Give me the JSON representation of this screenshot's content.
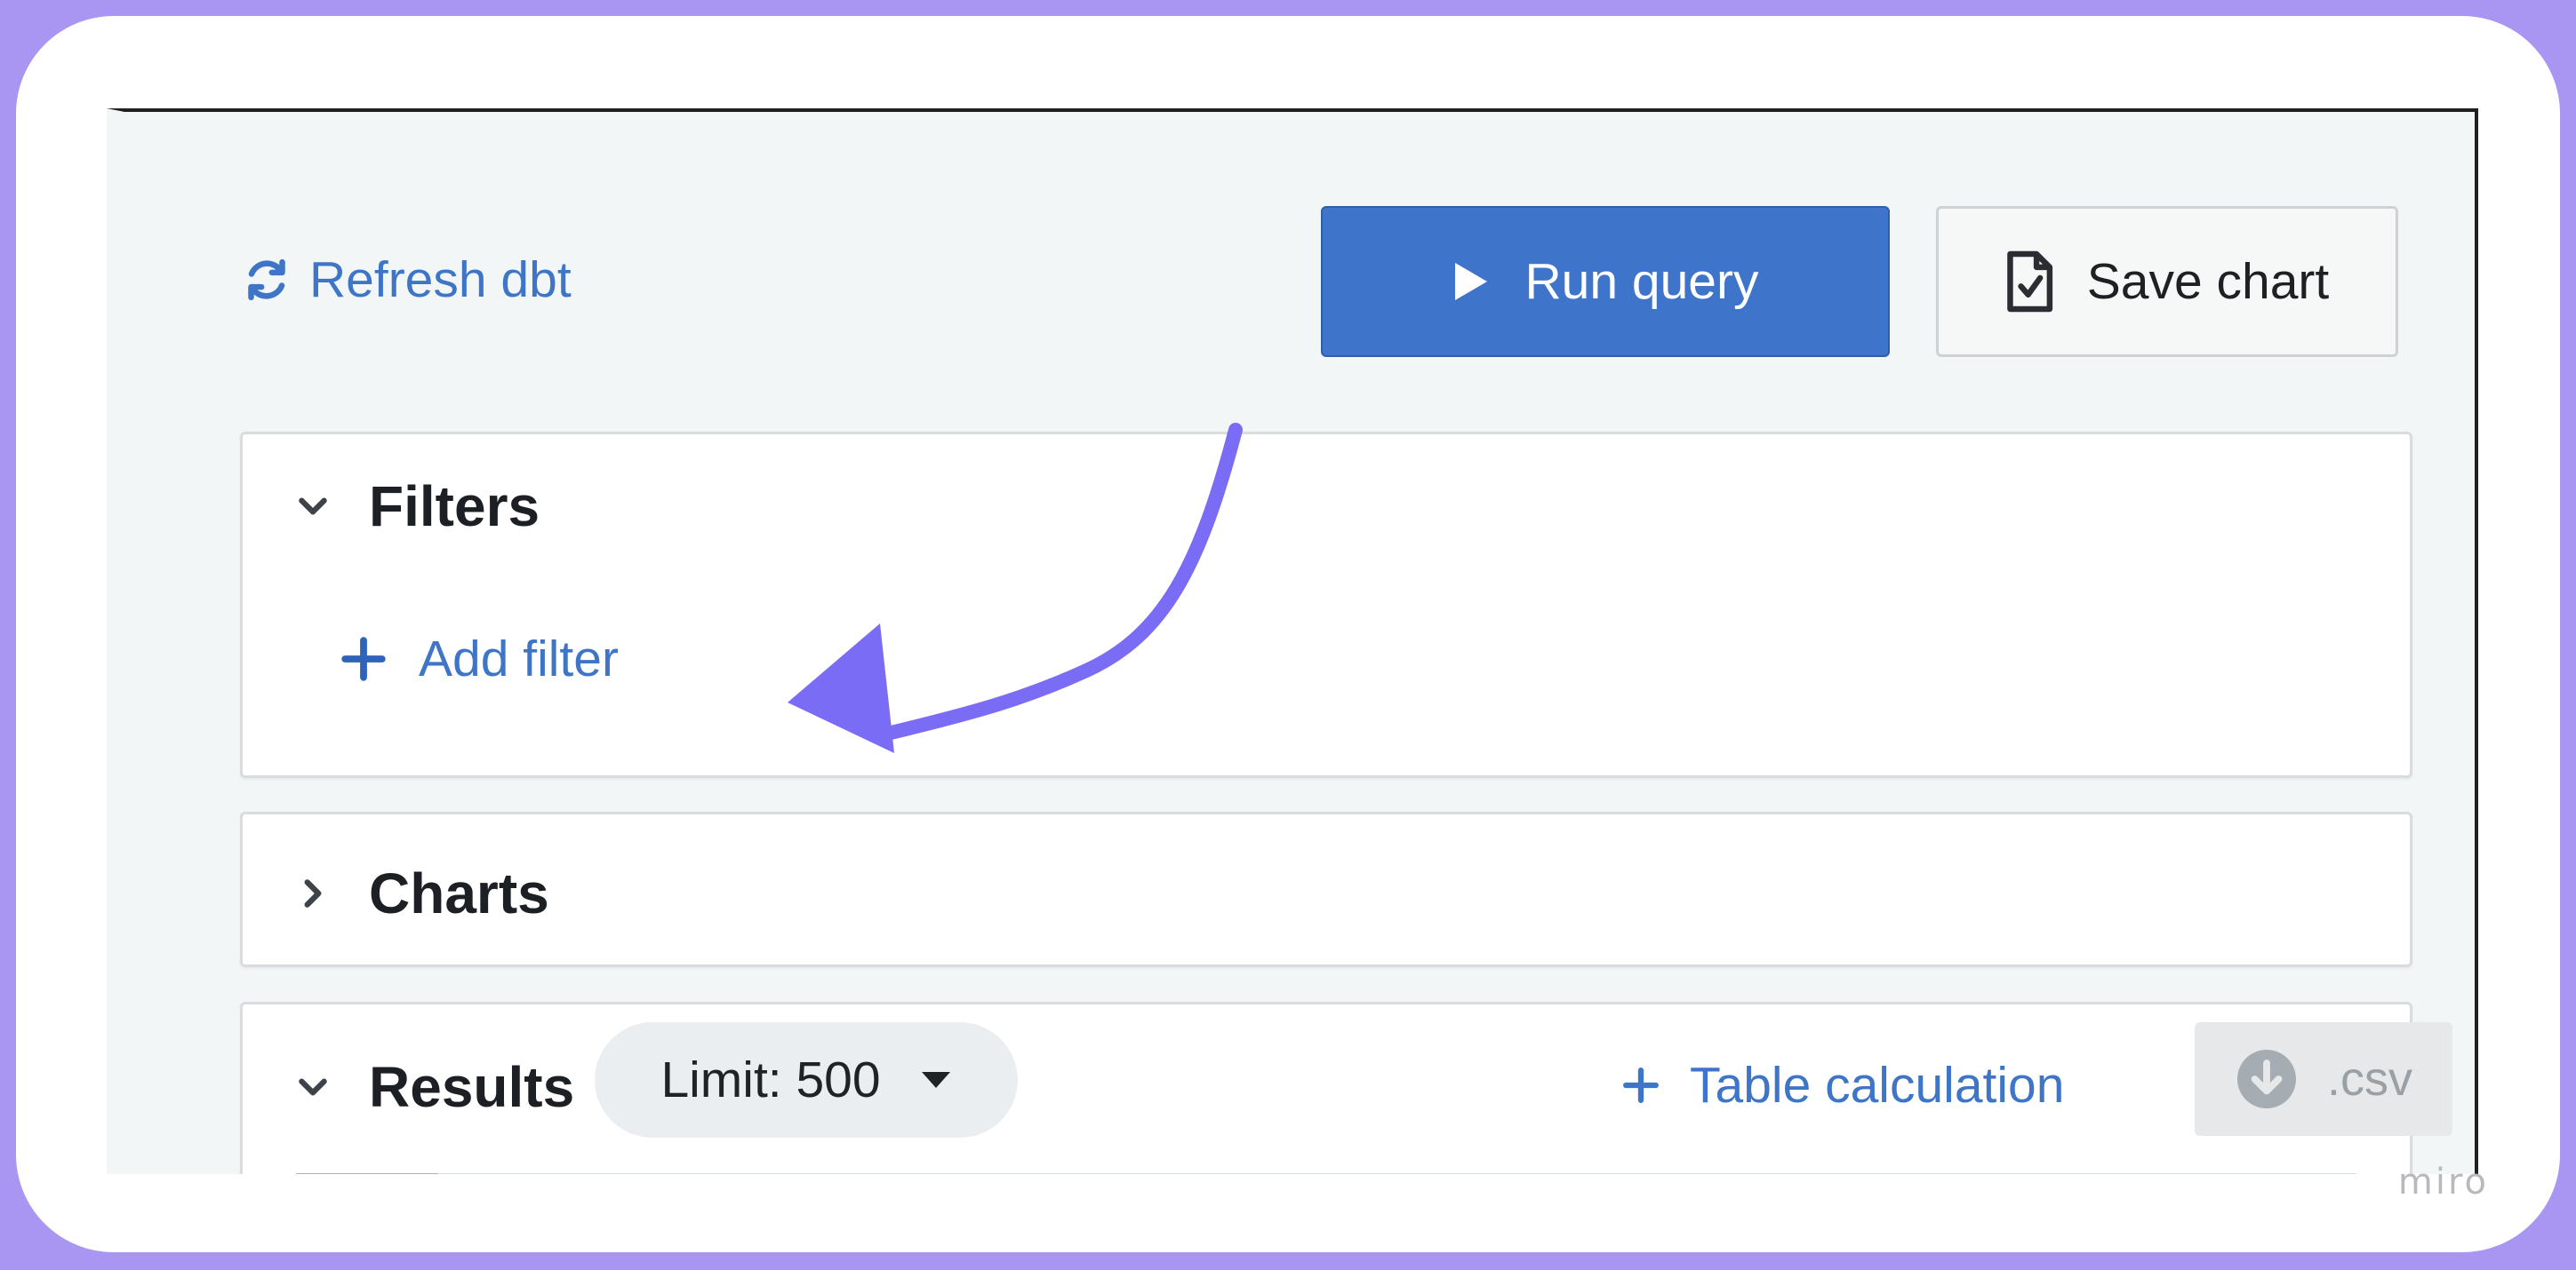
{
  "toolbar": {
    "refresh_label": "Refresh dbt",
    "run_label": "Run query",
    "save_label": "Save chart"
  },
  "filters": {
    "title": "Filters",
    "expanded": true,
    "add_label": "Add filter"
  },
  "charts": {
    "title": "Charts",
    "expanded": false
  },
  "results": {
    "title": "Results",
    "expanded": true,
    "limit_label": "Limit: 500",
    "table_calc_label": "Table calculation",
    "csv_label": ".csv"
  },
  "annotation": {
    "arrow_color": "#7b6cf6"
  },
  "watermark": "miro",
  "colors": {
    "primary": "#3f74cb",
    "link": "#3f75c6",
    "frame": "#a996f2"
  },
  "icons": {
    "refresh": "refresh-icon",
    "run": "play-icon",
    "save": "document-check-icon",
    "add": "plus-icon",
    "expand": "chevron-down-icon",
    "collapse": "chevron-right-icon",
    "dropdown": "caret-down-icon",
    "download": "download-circle-icon"
  }
}
